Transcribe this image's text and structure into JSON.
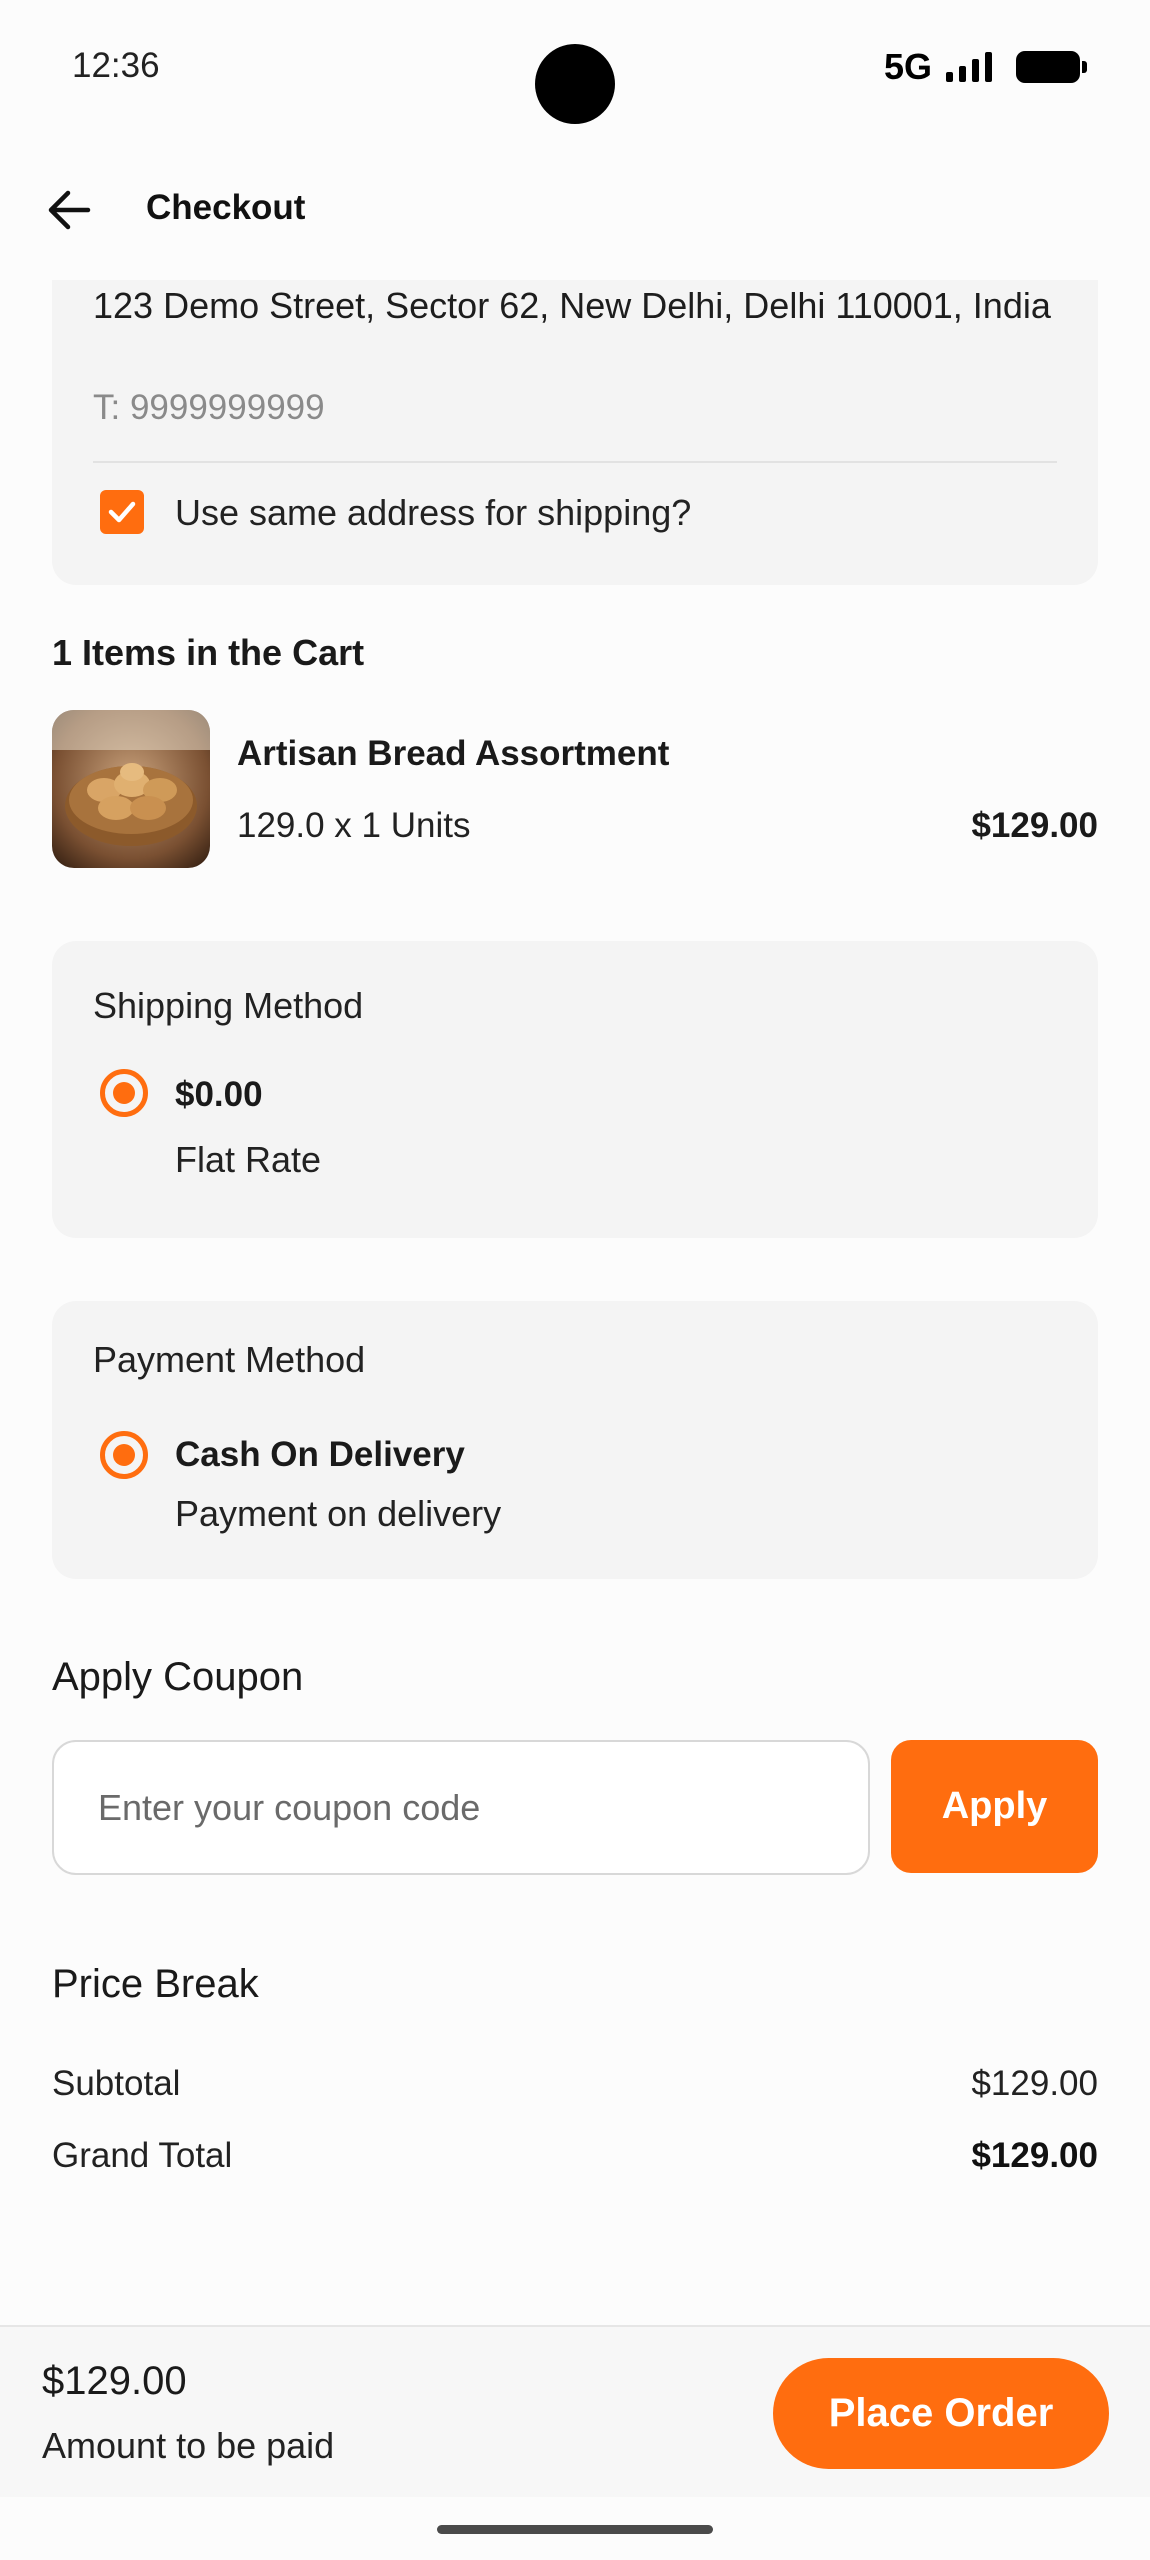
{
  "status_bar": {
    "time": "12:36",
    "network": "5G"
  },
  "app_bar": {
    "title": "Checkout",
    "back_icon": "arrow-left-icon"
  },
  "billing_address": {
    "address": "123 Demo Street, Sector 62, New Delhi, Delhi 110001, India",
    "phone": "T: 9999999999",
    "same_shipping_label": "Use same address for shipping?",
    "same_shipping_checked": true
  },
  "cart": {
    "title": "1 Items in the Cart",
    "items": [
      {
        "name": "Artisan Bread Assortment",
        "qty_text": "129.0 x 1 Units",
        "price": "$129.00"
      }
    ]
  },
  "shipping": {
    "title": "Shipping Method",
    "options": [
      {
        "price": "$0.00",
        "label": "Flat Rate",
        "selected": true
      }
    ]
  },
  "payment": {
    "title": "Payment Method",
    "options": [
      {
        "label": "Cash On Delivery",
        "description": "Payment on delivery",
        "selected": true
      }
    ]
  },
  "coupon": {
    "title": "Apply Coupon",
    "placeholder": "Enter your coupon code",
    "value": "",
    "button": "Apply"
  },
  "price_break": {
    "title": "Price Break",
    "rows": [
      {
        "label": "Subtotal",
        "value": "$129.00"
      },
      {
        "label": "Grand Total",
        "value": "$129.00"
      }
    ]
  },
  "footer": {
    "amount": "$129.00",
    "amount_label": "Amount to be paid",
    "button": "Place Order"
  },
  "colors": {
    "accent": "#ff6d0f",
    "card_bg": "#f4f4f4",
    "page_bg": "#fcfcfc"
  }
}
